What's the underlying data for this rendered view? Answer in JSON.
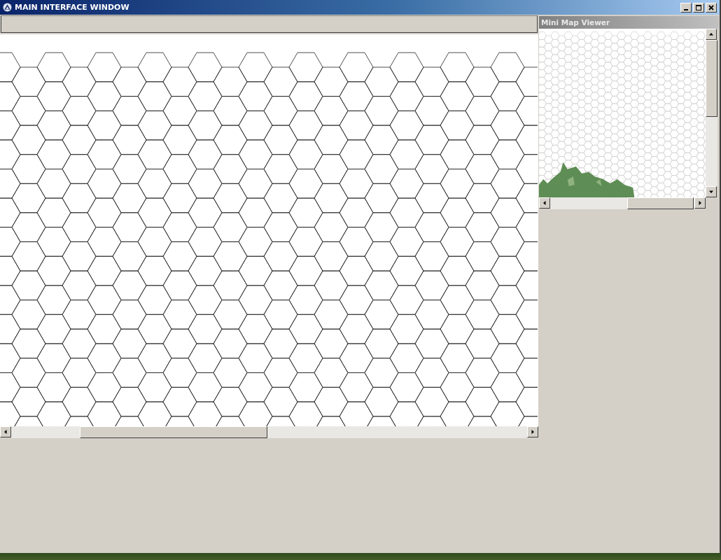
{
  "window": {
    "title": "MAIN INTERFACE WINDOW"
  },
  "mini_map": {
    "title": "Mini Map Viewer"
  }
}
